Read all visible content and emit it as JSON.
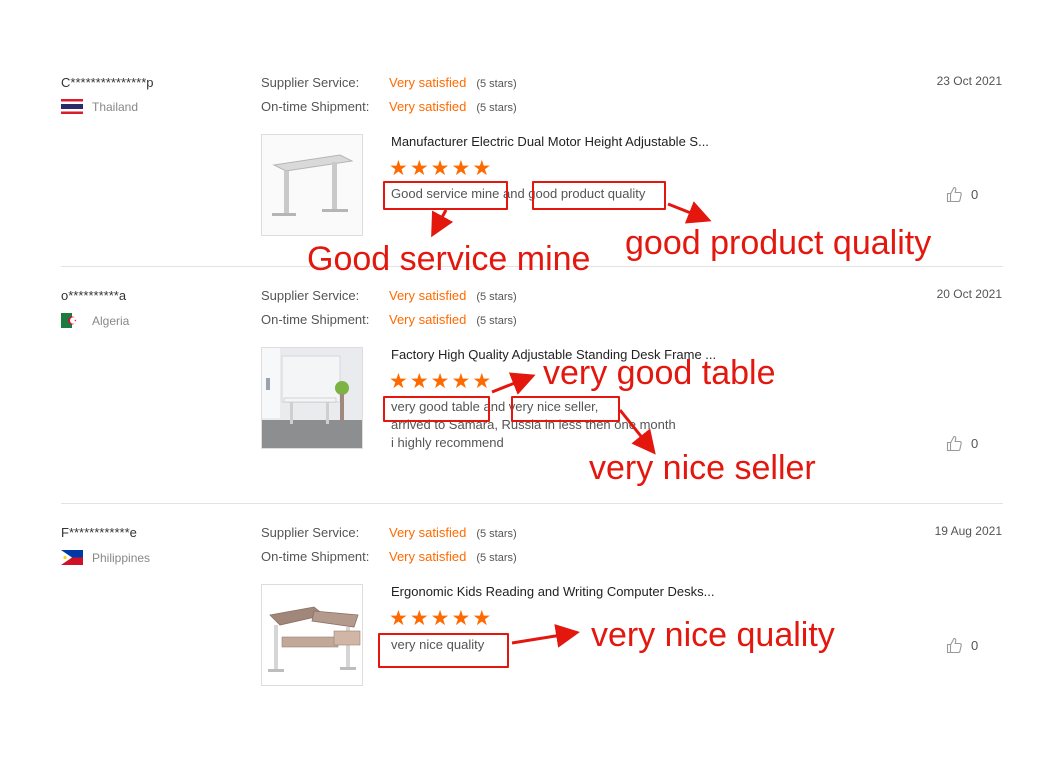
{
  "reviews": [
    {
      "user": "C***************p",
      "country": "Thailand",
      "supplier_label": "Supplier Service:",
      "supplier_value": "Very satisfied",
      "supplier_stars": "(5 stars)",
      "shipment_label": "On-time Shipment:",
      "shipment_value": "Very satisfied",
      "shipment_stars": "(5 stars)",
      "date": "23 Oct 2021",
      "product_title": "Manufacturer Electric Dual Motor Height Adjustable S...",
      "text_lines": [
        "Good service mine and good product quality"
      ],
      "likes": "0"
    },
    {
      "user": "o**********a",
      "country": "Algeria",
      "supplier_label": "Supplier Service:",
      "supplier_value": "Very satisfied",
      "supplier_stars": "(5 stars)",
      "shipment_label": "On-time Shipment:",
      "shipment_value": "Very satisfied",
      "shipment_stars": "(5 stars)",
      "date": "20 Oct 2021",
      "product_title": "Factory High Quality Adjustable Standing Desk Frame ...",
      "text_lines": [
        "very good table and very nice seller,",
        "arrived to Samara, Russia in less then one month",
        "i highly recommend"
      ],
      "likes": "0"
    },
    {
      "user": "F************e",
      "country": "Philippines",
      "supplier_label": "Supplier Service:",
      "supplier_value": "Very satisfied",
      "supplier_stars": "(5 stars)",
      "shipment_label": "On-time Shipment:",
      "shipment_value": "Very satisfied",
      "shipment_stars": "(5 stars)",
      "date": "19 Aug 2021",
      "product_title": "Ergonomic Kids Reading and Writing Computer Desks...",
      "text_lines": [
        "very nice quality"
      ],
      "likes": "0"
    }
  ],
  "annotations": {
    "good_service": "Good service mine",
    "good_quality": "good product quality",
    "very_good_table": "very good table",
    "very_nice_seller": "very nice seller",
    "very_nice_quality": "very nice quality"
  },
  "icons": {
    "star": "star-icon",
    "like": "thumbs-up-icon"
  },
  "colors": {
    "accent": "#ff6a00",
    "annotation_red": "#e3170d"
  }
}
